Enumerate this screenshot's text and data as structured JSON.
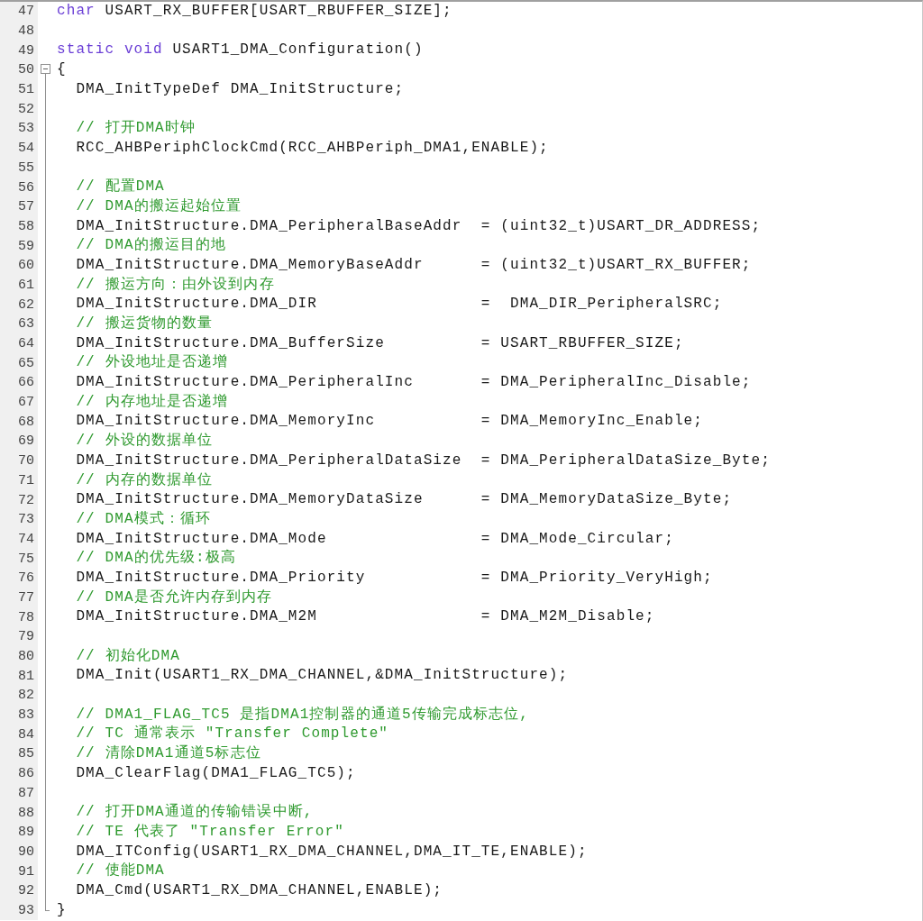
{
  "editor": {
    "lines": [
      {
        "number": "47",
        "tokens": [
          {
            "kind": "keyword",
            "text": "char"
          },
          {
            "kind": "plain",
            "text": " USART_RX_BUFFER[USART_RBUFFER_SIZE];"
          }
        ]
      },
      {
        "number": "48"
      },
      {
        "number": "49",
        "tokens": [
          {
            "kind": "keyword",
            "text": "static void"
          },
          {
            "kind": "plain",
            "text": " USART1_DMA_Configuration()"
          }
        ]
      },
      {
        "number": "50",
        "expanded": true,
        "tokens": [
          {
            "kind": "plain",
            "text": "{"
          }
        ]
      },
      {
        "number": "51",
        "in_block": true,
        "tokens": [
          {
            "kind": "plain",
            "text": "  DMA_InitTypeDef DMA_InitStructure;"
          }
        ]
      },
      {
        "number": "52",
        "in_block": true
      },
      {
        "number": "53",
        "in_block": true,
        "tokens": [
          {
            "kind": "comment",
            "text": "  // 打开DMA时钟"
          }
        ]
      },
      {
        "number": "54",
        "in_block": true,
        "tokens": [
          {
            "kind": "plain",
            "text": "  RCC_AHBPeriphClockCmd(RCC_AHBPeriph_DMA1,ENABLE);"
          }
        ]
      },
      {
        "number": "55",
        "in_block": true
      },
      {
        "number": "56",
        "in_block": true,
        "tokens": [
          {
            "kind": "comment",
            "text": "  // 配置DMA"
          }
        ]
      },
      {
        "number": "57",
        "in_block": true,
        "tokens": [
          {
            "kind": "comment",
            "text": "  // DMA的搬运起始位置"
          }
        ]
      },
      {
        "number": "58",
        "in_block": true,
        "tokens": [
          {
            "kind": "plain",
            "text": "  DMA_InitStructure.DMA_PeripheralBaseAddr  = (uint32_t)USART_DR_ADDRESS;"
          }
        ]
      },
      {
        "number": "59",
        "in_block": true,
        "tokens": [
          {
            "kind": "comment",
            "text": "  // DMA的搬运目的地"
          }
        ]
      },
      {
        "number": "60",
        "in_block": true,
        "tokens": [
          {
            "kind": "plain",
            "text": "  DMA_InitStructure.DMA_MemoryBaseAddr      = (uint32_t)USART_RX_BUFFER;"
          }
        ]
      },
      {
        "number": "61",
        "in_block": true,
        "tokens": [
          {
            "kind": "comment",
            "text": "  // 搬运方向：由外设到内存"
          }
        ]
      },
      {
        "number": "62",
        "in_block": true,
        "tokens": [
          {
            "kind": "plain",
            "text": "  DMA_InitStructure.DMA_DIR                 =  DMA_DIR_PeripheralSRC;"
          }
        ]
      },
      {
        "number": "63",
        "in_block": true,
        "tokens": [
          {
            "kind": "comment",
            "text": "  // 搬运货物的数量"
          }
        ]
      },
      {
        "number": "64",
        "in_block": true,
        "tokens": [
          {
            "kind": "plain",
            "text": "  DMA_InitStructure.DMA_BufferSize          = USART_RBUFFER_SIZE;"
          }
        ]
      },
      {
        "number": "65",
        "in_block": true,
        "tokens": [
          {
            "kind": "comment",
            "text": "  // 外设地址是否递增"
          }
        ]
      },
      {
        "number": "66",
        "in_block": true,
        "tokens": [
          {
            "kind": "plain",
            "text": "  DMA_InitStructure.DMA_PeripheralInc       = DMA_PeripheralInc_Disable;"
          }
        ]
      },
      {
        "number": "67",
        "in_block": true,
        "tokens": [
          {
            "kind": "comment",
            "text": "  // 内存地址是否递增"
          }
        ]
      },
      {
        "number": "68",
        "in_block": true,
        "tokens": [
          {
            "kind": "plain",
            "text": "  DMA_InitStructure.DMA_MemoryInc           = DMA_MemoryInc_Enable;"
          }
        ]
      },
      {
        "number": "69",
        "in_block": true,
        "tokens": [
          {
            "kind": "comment",
            "text": "  // 外设的数据单位"
          }
        ]
      },
      {
        "number": "70",
        "in_block": true,
        "tokens": [
          {
            "kind": "plain",
            "text": "  DMA_InitStructure.DMA_PeripheralDataSize  = DMA_PeripheralDataSize_Byte;"
          }
        ]
      },
      {
        "number": "71",
        "in_block": true,
        "tokens": [
          {
            "kind": "comment",
            "text": "  // 内存的数据单位"
          }
        ]
      },
      {
        "number": "72",
        "in_block": true,
        "tokens": [
          {
            "kind": "plain",
            "text": "  DMA_InitStructure.DMA_MemoryDataSize      = DMA_MemoryDataSize_Byte;"
          }
        ]
      },
      {
        "number": "73",
        "in_block": true,
        "tokens": [
          {
            "kind": "comment",
            "text": "  // DMA模式：循环"
          }
        ]
      },
      {
        "number": "74",
        "in_block": true,
        "tokens": [
          {
            "kind": "plain",
            "text": "  DMA_InitStructure.DMA_Mode                = DMA_Mode_Circular;"
          }
        ]
      },
      {
        "number": "75",
        "in_block": true,
        "tokens": [
          {
            "kind": "comment",
            "text": "  // DMA的优先级:极高"
          }
        ]
      },
      {
        "number": "76",
        "in_block": true,
        "tokens": [
          {
            "kind": "plain",
            "text": "  DMA_InitStructure.DMA_Priority            = DMA_Priority_VeryHigh;"
          }
        ]
      },
      {
        "number": "77",
        "in_block": true,
        "tokens": [
          {
            "kind": "comment",
            "text": "  // DMA是否允许内存到内存"
          }
        ]
      },
      {
        "number": "78",
        "in_block": true,
        "tokens": [
          {
            "kind": "plain",
            "text": "  DMA_InitStructure.DMA_M2M                 = DMA_M2M_Disable;"
          }
        ]
      },
      {
        "number": "79",
        "in_block": true
      },
      {
        "number": "80",
        "in_block": true,
        "tokens": [
          {
            "kind": "comment",
            "text": "  // 初始化DMA"
          }
        ]
      },
      {
        "number": "81",
        "in_block": true,
        "tokens": [
          {
            "kind": "plain",
            "text": "  DMA_Init(USART1_RX_DMA_CHANNEL,&DMA_InitStructure);"
          }
        ]
      },
      {
        "number": "82",
        "in_block": true
      },
      {
        "number": "83",
        "in_block": true,
        "tokens": [
          {
            "kind": "comment",
            "text": "  // DMA1_FLAG_TC5 是指DMA1控制器的通道5传输完成标志位,"
          }
        ]
      },
      {
        "number": "84",
        "in_block": true,
        "tokens": [
          {
            "kind": "comment",
            "text": "  // TC 通常表示 \"Transfer Complete\""
          }
        ]
      },
      {
        "number": "85",
        "in_block": true,
        "tokens": [
          {
            "kind": "comment",
            "text": "  // 清除DMA1通道5标志位"
          }
        ]
      },
      {
        "number": "86",
        "in_block": true,
        "tokens": [
          {
            "kind": "plain",
            "text": "  DMA_ClearFlag(DMA1_FLAG_TC5);"
          }
        ]
      },
      {
        "number": "87",
        "in_block": true
      },
      {
        "number": "88",
        "in_block": true,
        "tokens": [
          {
            "kind": "comment",
            "text": "  // 打开DMA通道的传输错误中断,"
          }
        ]
      },
      {
        "number": "89",
        "in_block": true,
        "tokens": [
          {
            "kind": "comment",
            "text": "  // TE 代表了 \"Transfer Error\""
          }
        ]
      },
      {
        "number": "90",
        "in_block": true,
        "tokens": [
          {
            "kind": "plain",
            "text": "  DMA_ITConfig(USART1_RX_DMA_CHANNEL,DMA_IT_TE,ENABLE);"
          }
        ]
      },
      {
        "number": "91",
        "in_block": true,
        "tokens": [
          {
            "kind": "comment",
            "text": "  // 使能DMA"
          }
        ]
      },
      {
        "number": "92",
        "in_block": true,
        "tokens": [
          {
            "kind": "plain",
            "text": "  DMA_Cmd(USART1_RX_DMA_CHANNEL,ENABLE);"
          }
        ]
      },
      {
        "number": "93",
        "block_end": true,
        "tokens": [
          {
            "kind": "plain",
            "text": "}"
          }
        ]
      }
    ]
  }
}
